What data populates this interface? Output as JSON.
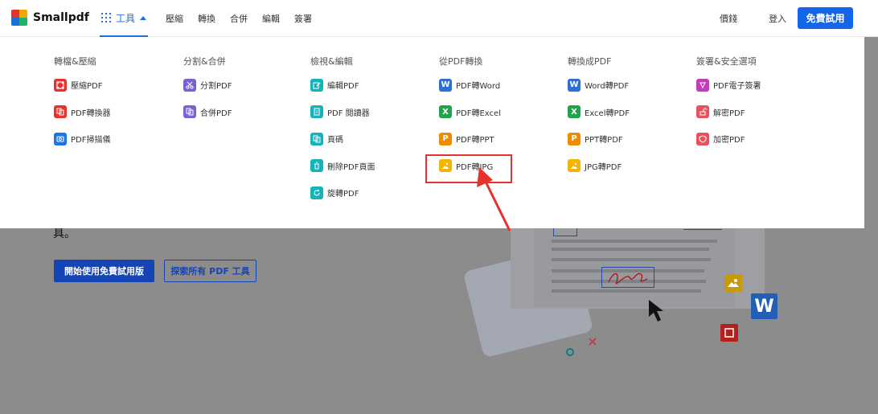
{
  "header": {
    "logo_text": "Smallpdf",
    "tools_label": "工具",
    "nav": [
      "壓縮",
      "轉換",
      "合併",
      "編輯",
      "簽署"
    ],
    "pricing": "價錢",
    "login": "登入",
    "free_trial": "免費試用"
  },
  "menu": {
    "columns": [
      {
        "title": "轉檔&壓縮",
        "items": [
          {
            "label": "壓縮PDF",
            "icon": "compress-icon"
          },
          {
            "label": "PDF轉換器",
            "icon": "converter-icon"
          },
          {
            "label": "PDF掃描儀",
            "icon": "scanner-icon"
          }
        ]
      },
      {
        "title": "分割&合併",
        "items": [
          {
            "label": "分割PDF",
            "icon": "scissors-icon"
          },
          {
            "label": "合併PDF",
            "icon": "merge-icon"
          }
        ]
      },
      {
        "title": "檢視&編輯",
        "items": [
          {
            "label": "編輯PDF",
            "icon": "edit-icon"
          },
          {
            "label": "PDF 閱讀器",
            "icon": "reader-icon"
          },
          {
            "label": "頁碼",
            "icon": "page-number-icon"
          },
          {
            "label": "刪除PDF頁面",
            "icon": "trash-icon"
          },
          {
            "label": "旋轉PDF",
            "icon": "rotate-icon"
          }
        ]
      },
      {
        "title": "從PDF轉換",
        "items": [
          {
            "label": "PDF轉Word",
            "icon": "word-icon"
          },
          {
            "label": "PDF轉Excel",
            "icon": "excel-icon"
          },
          {
            "label": "PDF轉PPT",
            "icon": "ppt-icon"
          },
          {
            "label": "PDF轉JPG",
            "icon": "jpg-icon"
          }
        ]
      },
      {
        "title": "轉換成PDF",
        "items": [
          {
            "label": "Word轉PDF",
            "icon": "word-icon"
          },
          {
            "label": "Excel轉PDF",
            "icon": "excel-icon"
          },
          {
            "label": "PPT轉PDF",
            "icon": "ppt-icon"
          },
          {
            "label": "JPG轉PDF",
            "icon": "jpg-icon"
          }
        ]
      },
      {
        "title": "簽署&安全選項",
        "items": [
          {
            "label": "PDF電子簽署",
            "icon": "esign-icon"
          },
          {
            "label": "解密PDF",
            "icon": "unlock-icon"
          },
          {
            "label": "加密PDF",
            "icon": "shield-icon"
          }
        ]
      }
    ]
  },
  "hero": {
    "text_fragment": "具。",
    "primary_button": "開始使用免費試用版",
    "secondary_button": "探索所有 PDF 工具"
  },
  "colors": {
    "brand_blue": "#1565e8",
    "highlight_red": "#e5322d",
    "overlay_gray": "#8c8c8c"
  }
}
